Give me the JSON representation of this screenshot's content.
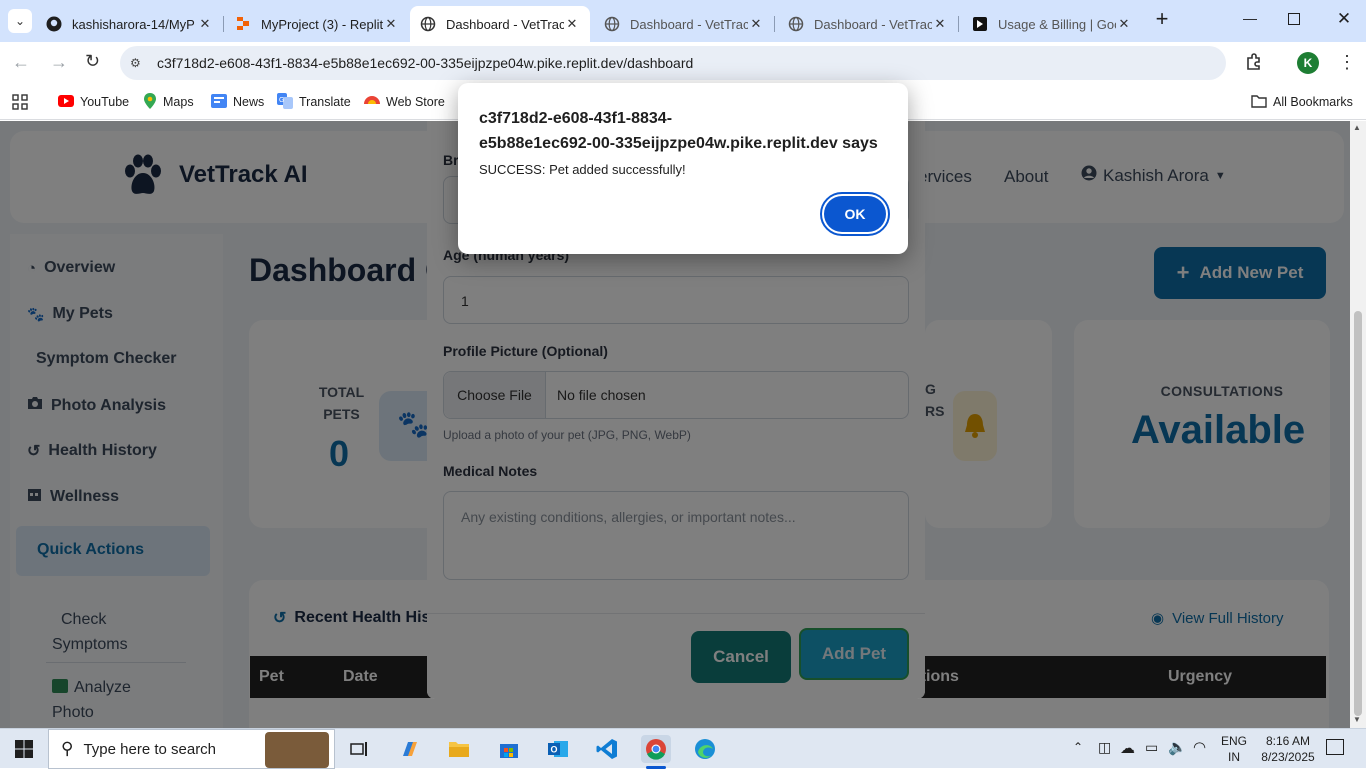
{
  "browser": {
    "tabs": [
      {
        "title": "kashisharora-14/MyP",
        "icon": "github-icon"
      },
      {
        "title": "MyProject (3) - Replit",
        "icon": "replit-icon"
      },
      {
        "title": "Dashboard - VetTrack",
        "icon": "globe-icon"
      },
      {
        "title": "Dashboard - VetTrack",
        "icon": "globe-icon"
      },
      {
        "title": "Dashboard - VetTrack",
        "icon": "globe-icon"
      },
      {
        "title": "Usage & Billing | Goo",
        "icon": "cursor-icon"
      }
    ],
    "url": "c3f718d2-e608-43f1-8834-e5b88e1ec692-00-335eijpzpe04w.pike.replit.dev/dashboard",
    "profile_initial": "K",
    "bookmarks": [
      "YouTube",
      "Maps",
      "News",
      "Translate",
      "Web Store"
    ],
    "all_bookmarks": "All Bookmarks"
  },
  "app": {
    "brand": "VetTrack AI",
    "nav": {
      "services": "ervices",
      "about": "About",
      "user": "Kashish Arora"
    },
    "page_title": "Dashboard O",
    "add_new_pet": "Add New Pet",
    "sidebar": [
      "Overview",
      "My Pets",
      "Symptom Checker",
      "Photo Analysis",
      "Health History",
      "Wellness"
    ],
    "quick_actions": {
      "title": "Quick Actions",
      "check_symptoms": "Check Symptoms",
      "analyze_photo": "Analyze Photo"
    },
    "stats": {
      "total_pets_label": "TOTAL PETS",
      "total_pets_value": "0",
      "reminders_partial_1": "G",
      "reminders_partial_2": "RS",
      "consultations_label": "CONSULTATIONS",
      "consultations_value": "Available"
    },
    "history": {
      "title": "Recent Health His",
      "view_full": "View Full History",
      "columns": [
        "Pet",
        "Date",
        "dations",
        "Urgency"
      ]
    }
  },
  "modal": {
    "breed_label_partial": "Br",
    "age_label": "Age (human years)",
    "age_value": "1",
    "profile_label": "Profile Picture (Optional)",
    "choose_file": "Choose File",
    "no_file": "No file chosen",
    "upload_hint": "Upload a photo of your pet (JPG, PNG, WebP)",
    "medical_label": "Medical Notes",
    "medical_placeholder": "Any existing conditions, allergies, or important notes...",
    "cancel": "Cancel",
    "add_pet": "Add Pet"
  },
  "alert": {
    "origin_line1": "c3f718d2-e608-43f1-8834-",
    "origin_line2": "e5b88e1ec692-00-335eijpzpe04w.pike.replit.dev says",
    "message": "SUCCESS: Pet added successfully!",
    "ok": "OK"
  },
  "taskbar": {
    "search_placeholder": "Type here to search",
    "lang1": "ENG",
    "lang2": "IN",
    "time": "8:16 AM",
    "date": "8/23/2025"
  },
  "colors": {
    "accent": "#0e6ea8",
    "teal": "#137a76",
    "alert_ok": "#0b57d0"
  }
}
